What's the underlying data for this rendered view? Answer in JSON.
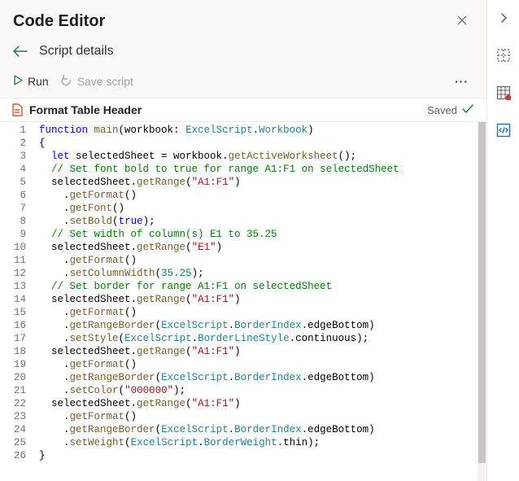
{
  "header": {
    "title": "Code Editor"
  },
  "breadcrumb": {
    "text": "Script details"
  },
  "toolbar": {
    "run_label": "Run",
    "save_label": "Save script",
    "more_label": "···"
  },
  "file": {
    "name": "Format Table Header",
    "saved_label": "Saved"
  },
  "code": {
    "lines": [
      {
        "n": 1,
        "indent": 0,
        "tokens": [
          [
            "kw",
            "function"
          ],
          [
            "",
            " "
          ],
          [
            "fn",
            "main"
          ],
          [
            "",
            "(workbook: "
          ],
          [
            "type",
            "ExcelScript"
          ],
          [
            "",
            "."
          ],
          [
            "type",
            "Workbook"
          ],
          [
            "",
            ")"
          ]
        ]
      },
      {
        "n": 2,
        "indent": 0,
        "tokens": [
          [
            "",
            "{"
          ]
        ]
      },
      {
        "n": 3,
        "indent": 1,
        "tokens": [
          [
            "kw",
            "let"
          ],
          [
            "",
            " selectedSheet = workbook."
          ],
          [
            "fn",
            "getActiveWorksheet"
          ],
          [
            "",
            "();"
          ]
        ]
      },
      {
        "n": 4,
        "indent": 1,
        "tokens": [
          [
            "cm",
            "// Set font bold to true for range A1:F1 on selectedSheet"
          ]
        ]
      },
      {
        "n": 5,
        "indent": 1,
        "tokens": [
          [
            "",
            "selectedSheet."
          ],
          [
            "fn",
            "getRange"
          ],
          [
            "",
            "("
          ],
          [
            "str",
            "\"A1:F1\""
          ],
          [
            "",
            ")"
          ]
        ]
      },
      {
        "n": 6,
        "indent": 2,
        "tokens": [
          [
            "",
            "."
          ],
          [
            "fn",
            "getFormat"
          ],
          [
            "",
            "()"
          ]
        ]
      },
      {
        "n": 7,
        "indent": 2,
        "tokens": [
          [
            "",
            "."
          ],
          [
            "fn",
            "getFont"
          ],
          [
            "",
            "()"
          ]
        ]
      },
      {
        "n": 8,
        "indent": 2,
        "tokens": [
          [
            "",
            "."
          ],
          [
            "fn",
            "setBold"
          ],
          [
            "",
            "("
          ],
          [
            "bool",
            "true"
          ],
          [
            "",
            ");"
          ]
        ]
      },
      {
        "n": 9,
        "indent": 1,
        "tokens": [
          [
            "cm",
            "// Set width of column(s) E1 to 35.25"
          ]
        ]
      },
      {
        "n": 10,
        "indent": 1,
        "tokens": [
          [
            "",
            "selectedSheet."
          ],
          [
            "fn",
            "getRange"
          ],
          [
            "",
            "("
          ],
          [
            "str",
            "\"E1\""
          ],
          [
            "",
            ")"
          ]
        ]
      },
      {
        "n": 11,
        "indent": 2,
        "tokens": [
          [
            "",
            "."
          ],
          [
            "fn",
            "getFormat"
          ],
          [
            "",
            "()"
          ]
        ]
      },
      {
        "n": 12,
        "indent": 2,
        "tokens": [
          [
            "",
            "."
          ],
          [
            "fn",
            "setColumnWidth"
          ],
          [
            "",
            "("
          ],
          [
            "num",
            "35.25"
          ],
          [
            "",
            ");"
          ]
        ]
      },
      {
        "n": 13,
        "indent": 1,
        "tokens": [
          [
            "cm",
            "// Set border for range A1:F1 on selectedSheet"
          ]
        ]
      },
      {
        "n": 14,
        "indent": 1,
        "tokens": [
          [
            "",
            "selectedSheet."
          ],
          [
            "fn",
            "getRange"
          ],
          [
            "",
            "("
          ],
          [
            "str",
            "\"A1:F1\""
          ],
          [
            "",
            ")"
          ]
        ]
      },
      {
        "n": 15,
        "indent": 2,
        "tokens": [
          [
            "",
            "."
          ],
          [
            "fn",
            "getFormat"
          ],
          [
            "",
            "()"
          ]
        ]
      },
      {
        "n": 16,
        "indent": 2,
        "tokens": [
          [
            "",
            "."
          ],
          [
            "fn",
            "getRangeBorder"
          ],
          [
            "",
            "("
          ],
          [
            "type",
            "ExcelScript"
          ],
          [
            "",
            "."
          ],
          [
            "type",
            "BorderIndex"
          ],
          [
            "",
            ".edgeBottom)"
          ]
        ]
      },
      {
        "n": 17,
        "indent": 2,
        "tokens": [
          [
            "",
            "."
          ],
          [
            "fn",
            "setStyle"
          ],
          [
            "",
            "("
          ],
          [
            "type",
            "ExcelScript"
          ],
          [
            "",
            "."
          ],
          [
            "type",
            "BorderLineStyle"
          ],
          [
            "",
            ".continuous);"
          ]
        ]
      },
      {
        "n": 18,
        "indent": 1,
        "tokens": [
          [
            "",
            "selectedSheet."
          ],
          [
            "fn",
            "getRange"
          ],
          [
            "",
            "("
          ],
          [
            "str",
            "\"A1:F1\""
          ],
          [
            "",
            ")"
          ]
        ]
      },
      {
        "n": 19,
        "indent": 2,
        "tokens": [
          [
            "",
            "."
          ],
          [
            "fn",
            "getFormat"
          ],
          [
            "",
            "()"
          ]
        ]
      },
      {
        "n": 20,
        "indent": 2,
        "tokens": [
          [
            "",
            "."
          ],
          [
            "fn",
            "getRangeBorder"
          ],
          [
            "",
            "("
          ],
          [
            "type",
            "ExcelScript"
          ],
          [
            "",
            "."
          ],
          [
            "type",
            "BorderIndex"
          ],
          [
            "",
            ".edgeBottom)"
          ]
        ]
      },
      {
        "n": 21,
        "indent": 2,
        "tokens": [
          [
            "",
            "."
          ],
          [
            "fn",
            "setColor"
          ],
          [
            "",
            "("
          ],
          [
            "str",
            "\"000000\""
          ],
          [
            "",
            ");"
          ]
        ]
      },
      {
        "n": 22,
        "indent": 1,
        "tokens": [
          [
            "",
            "selectedSheet."
          ],
          [
            "fn",
            "getRange"
          ],
          [
            "",
            "("
          ],
          [
            "str",
            "\"A1:F1\""
          ],
          [
            "",
            ")"
          ]
        ]
      },
      {
        "n": 23,
        "indent": 2,
        "tokens": [
          [
            "",
            "."
          ],
          [
            "fn",
            "getFormat"
          ],
          [
            "",
            "()"
          ]
        ]
      },
      {
        "n": 24,
        "indent": 2,
        "tokens": [
          [
            "",
            "."
          ],
          [
            "fn",
            "getRangeBorder"
          ],
          [
            "",
            "("
          ],
          [
            "type",
            "ExcelScript"
          ],
          [
            "",
            "."
          ],
          [
            "type",
            "BorderIndex"
          ],
          [
            "",
            ".edgeBottom)"
          ]
        ]
      },
      {
        "n": 25,
        "indent": 2,
        "tokens": [
          [
            "",
            "."
          ],
          [
            "fn",
            "setWeight"
          ],
          [
            "",
            "("
          ],
          [
            "type",
            "ExcelScript"
          ],
          [
            "",
            "."
          ],
          [
            "type",
            "BorderWeight"
          ],
          [
            "",
            ".thin);"
          ]
        ]
      },
      {
        "n": 26,
        "indent": 0,
        "tokens": [
          [
            "",
            "}"
          ]
        ]
      }
    ]
  }
}
